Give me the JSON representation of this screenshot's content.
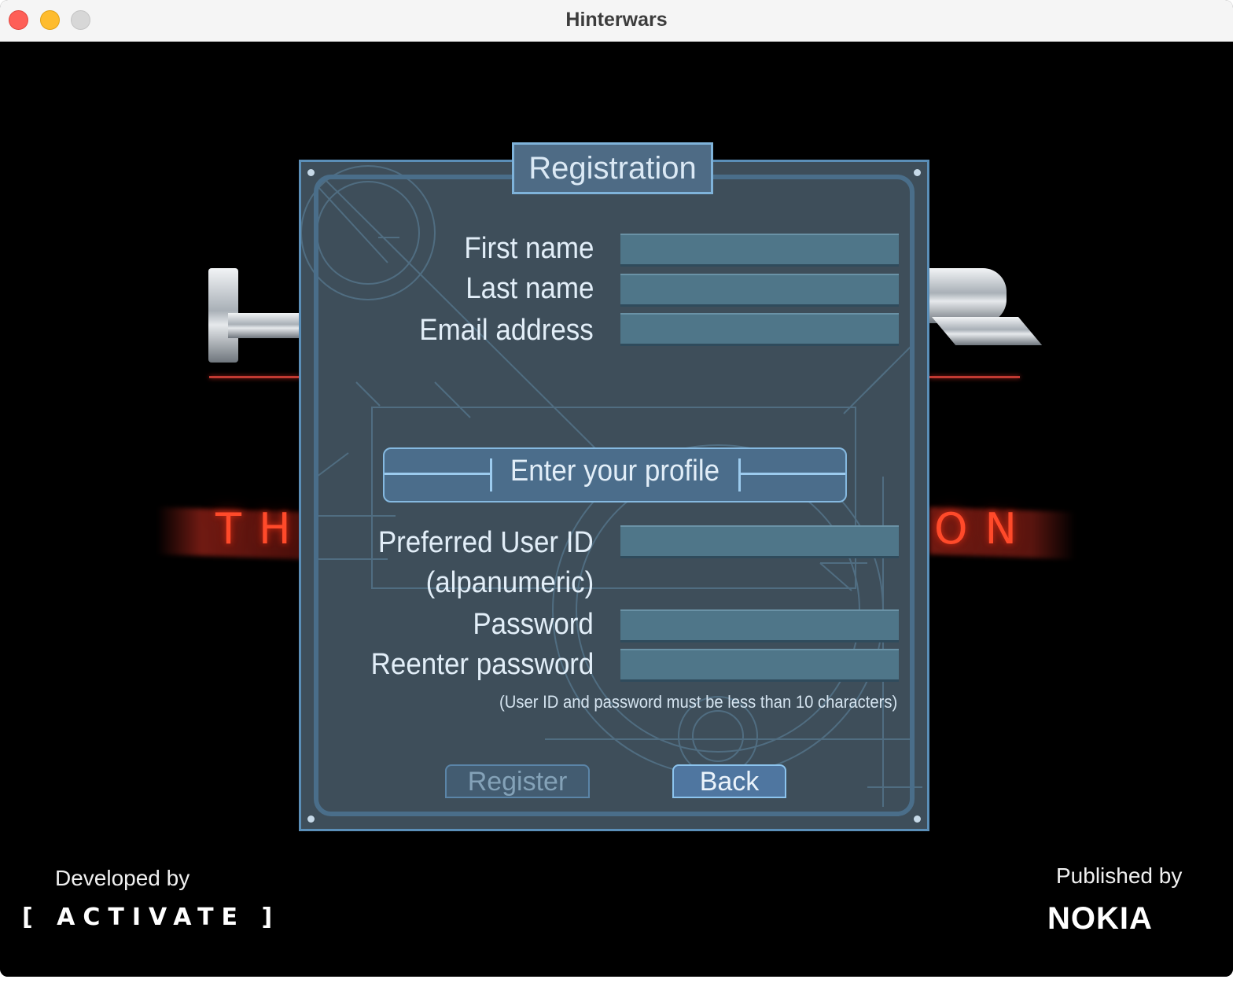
{
  "window": {
    "title": "Hinterwars"
  },
  "background": {
    "tagline_left": "TH",
    "tagline_right": "ON"
  },
  "dialog": {
    "title": "Registration",
    "fields_top": [
      {
        "label": "First name",
        "value": ""
      },
      {
        "label": "Last name",
        "value": ""
      },
      {
        "label": "Email address",
        "value": ""
      }
    ],
    "section_title": "Enter your profile",
    "fields_bottom": [
      {
        "label": "Preferred User ID",
        "label2": "(alpanumeric)",
        "value": ""
      },
      {
        "label": "Password",
        "value": ""
      },
      {
        "label": "Reenter password",
        "value": ""
      }
    ],
    "hint": "(User ID and password must be less than 10 characters)",
    "register_label": "Register",
    "back_label": "Back"
  },
  "credits": {
    "developed_by": "Developed by",
    "developer": "[ ACTIVATE ]",
    "published_by": "Published by",
    "publisher": "NOKIA"
  }
}
